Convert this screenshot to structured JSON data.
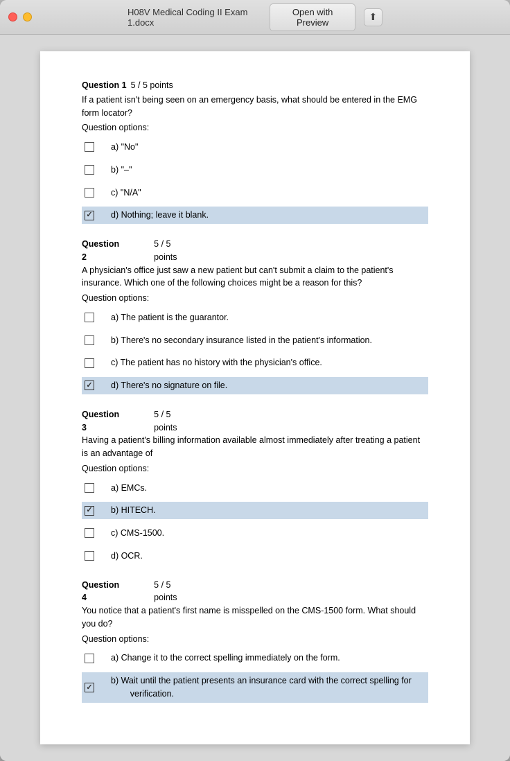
{
  "window": {
    "title": "H08V Medical Coding II Exam 1.docx",
    "open_preview_label": "Open with Preview",
    "share_icon": "↑"
  },
  "questions": [
    {
      "number": "1",
      "points": "5 / 5 points",
      "text": "If a patient isn't being seen on an emergency basis, what should be entered in the EMG form locator?",
      "options_label": "Question options:",
      "options": [
        {
          "letter": "a)",
          "text": "\"No\"",
          "selected": false
        },
        {
          "letter": "b)",
          "text": "\"–\"",
          "selected": false
        },
        {
          "letter": "c)",
          "text": "\"N/A\"",
          "selected": false
        },
        {
          "letter": "d)",
          "text": "Nothing; leave it blank.",
          "selected": true
        }
      ]
    },
    {
      "number": "2",
      "points": "5 / 5",
      "points2": "points",
      "text": "A physician's office just saw a new patient but can't submit a claim to the patient's insurance. Which one of the following choices might be a reason for this?",
      "options_label": "Question options:",
      "options": [
        {
          "letter": "a)",
          "text": "The patient is the guarantor.",
          "selected": false
        },
        {
          "letter": "b)",
          "text": "There's no secondary insurance listed in the patient's information.",
          "selected": false
        },
        {
          "letter": "c)",
          "text": "The patient has no history with the physician's office.",
          "selected": false
        },
        {
          "letter": "d)",
          "text": "There's no signature on file.",
          "selected": true
        }
      ]
    },
    {
      "number": "3",
      "points": "5 / 5",
      "points2": "points",
      "text": "Having a patient's billing information available almost immediately after treating a patient is an advantage of",
      "options_label": "Question options:",
      "options": [
        {
          "letter": "a)",
          "text": "EMCs.",
          "selected": false
        },
        {
          "letter": "b)",
          "text": "HITECH.",
          "selected": true
        },
        {
          "letter": "c)",
          "text": "CMS-1500.",
          "selected": false
        },
        {
          "letter": "d)",
          "text": "OCR.",
          "selected": false
        }
      ]
    },
    {
      "number": "4",
      "points": "5 / 5",
      "points2": "points",
      "text": "You notice that a patient's first name is misspelled on the CMS-1500 form. What should you do?",
      "options_label": "Question options:",
      "options": [
        {
          "letter": "a)",
          "text": "Change it to the correct spelling immediately on the form.",
          "selected": false
        },
        {
          "letter": "b)",
          "text": "Wait until the patient presents an insurance card with the correct spelling for verification.",
          "selected": true
        }
      ]
    }
  ]
}
